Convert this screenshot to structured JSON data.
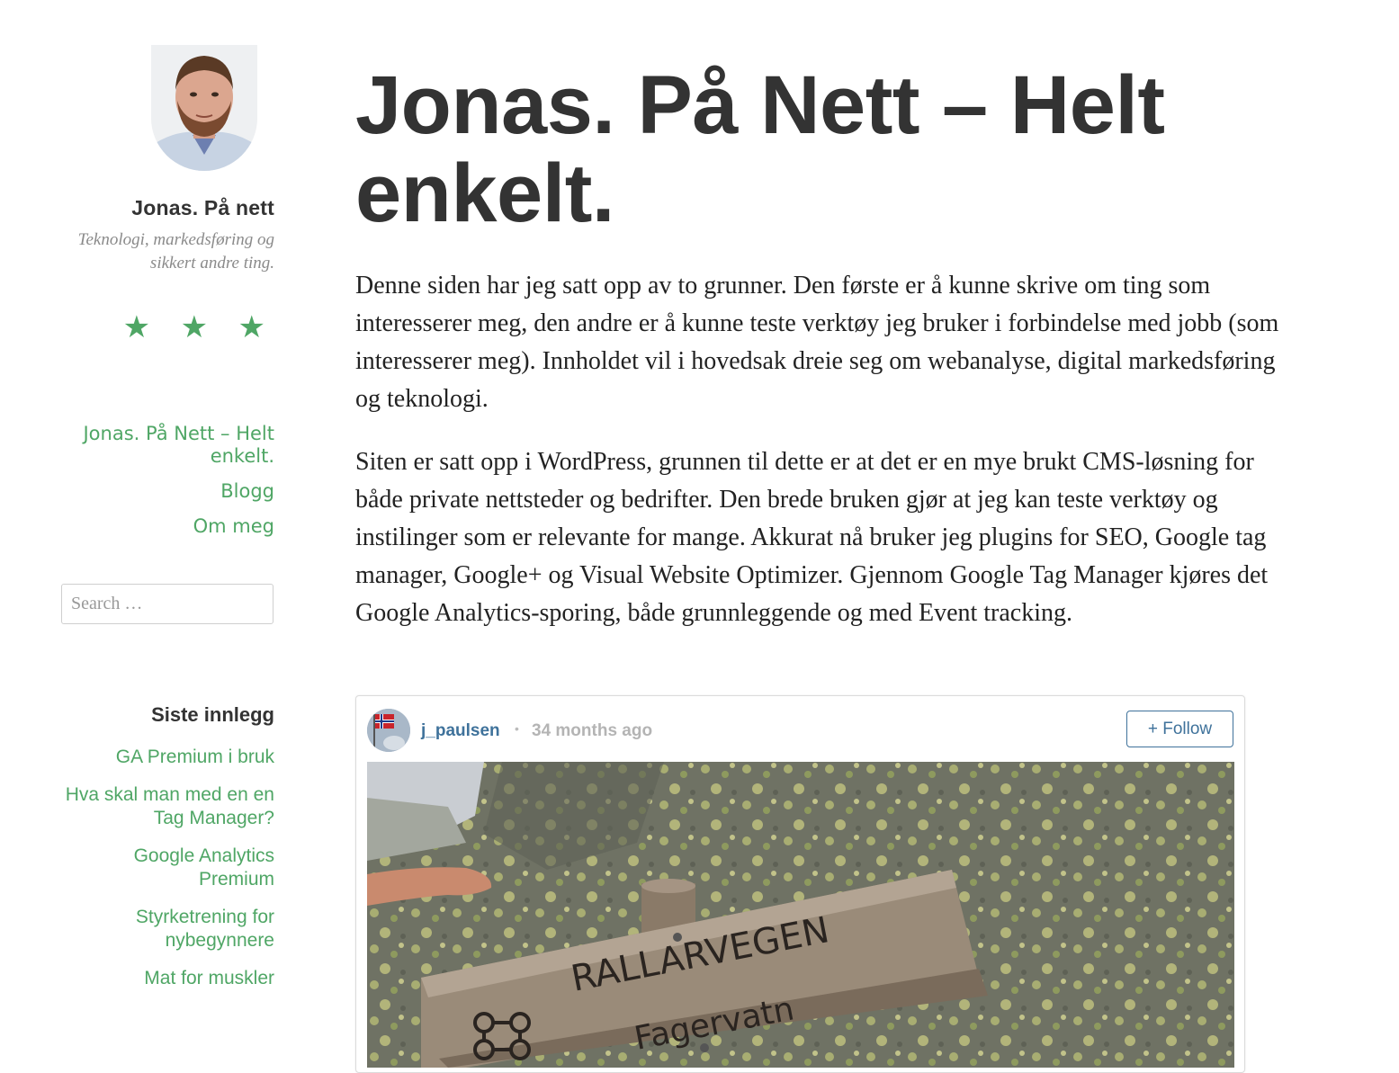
{
  "sidebar": {
    "site_title": "Jonas. På nett",
    "site_description": "Teknologi, markedsføring og sikkert andre ting.",
    "stars": [
      "★",
      "★",
      "★"
    ],
    "nav": [
      {
        "label": "Jonas. På Nett – Helt enkelt."
      },
      {
        "label": "Blogg"
      },
      {
        "label": "Om meg"
      }
    ],
    "search_placeholder": "Search …",
    "recent_title": "Siste innlegg",
    "recent_posts": [
      {
        "label": "GA Premium i bruk"
      },
      {
        "label": "Hva skal man med en en Tag Manager?"
      },
      {
        "label": "Google Analytics Premium"
      },
      {
        "label": "Styrketrening for nybegynnere"
      },
      {
        "label": "Mat for muskler"
      }
    ]
  },
  "main": {
    "title": "Jonas. På Nett – Helt enkelt.",
    "paragraphs": [
      "Denne siden har jeg satt opp av to grunner. Den første er å kunne skrive om ting som interesserer meg, den andre er å kunne teste verktøy jeg bruker i forbindelse med jobb (som interesserer meg). Innholdet vil i hovedsak dreie seg om webanalyse, digital markedsføring og teknologi.",
      "Siten er satt opp i WordPress, grunnen til dette er at det er en mye brukt CMS-løsning for både private nettsteder og bedrifter. Den brede bruken gjør at jeg kan teste verktøy og instilinger som er relevante for mange. Akkurat nå bruker jeg plugins for SEO, Google tag manager, Google+ og Visual Website Optimizer. Gjennom Google Tag Manager kjøres det Google Analytics-sporing, både grunnleggende og med Event tracking."
    ]
  },
  "embed": {
    "username": "j_paulsen",
    "separator": "•",
    "time": "34 months ago",
    "follow_label": "+ Follow",
    "photo_sign_line1": "RALLARVEGEN",
    "photo_sign_line2": "Fagervatn"
  },
  "colors": {
    "accent_green": "#4fa665",
    "instagram_blue": "#3f729b",
    "text_dark": "#333333"
  }
}
